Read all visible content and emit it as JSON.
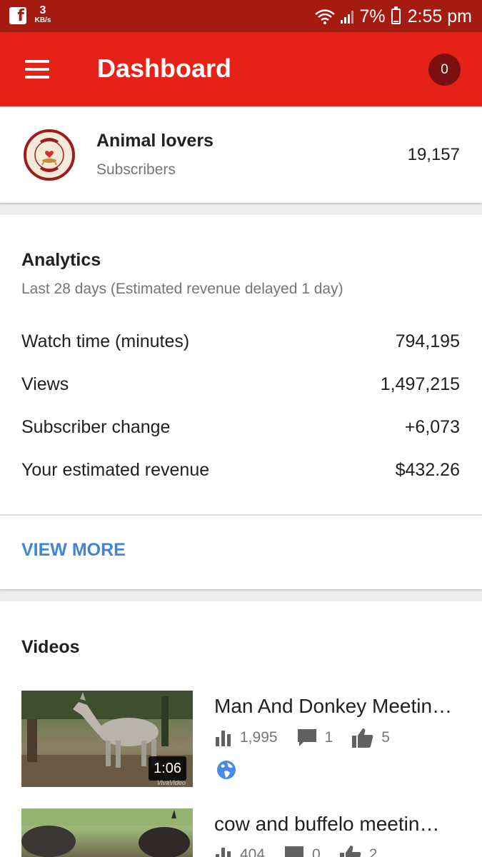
{
  "status_bar": {
    "app_icon": "facebook-icon",
    "net_speed": "3",
    "net_speed_unit": "KB/s",
    "battery": "7%",
    "time": "2:55 pm"
  },
  "app_bar": {
    "title": "Dashboard",
    "notification_count": "0",
    "color": "#e62117"
  },
  "channel": {
    "name": "Animal lovers",
    "subscribers_label": "Subscribers",
    "subscriber_count": "19,157"
  },
  "analytics": {
    "title": "Analytics",
    "subtitle": "Last 28 days (Estimated revenue delayed 1 day)",
    "metrics": [
      {
        "label": "Watch time (minutes)",
        "value": "794,195"
      },
      {
        "label": "Views",
        "value": "1,497,215"
      },
      {
        "label": "Subscriber change",
        "value": "+6,073"
      },
      {
        "label": "Your estimated revenue",
        "value": "$432.26"
      }
    ],
    "view_more": "VIEW MORE"
  },
  "videos": {
    "title": "Videos",
    "items": [
      {
        "title": "Man And Donkey Meetin…",
        "duration": "1:06",
        "views": "1,995",
        "comments": "1",
        "likes": "5",
        "visibility_icon": "globe-icon"
      },
      {
        "title": "cow and buffelo meetin…",
        "views": "404",
        "comments": "0",
        "likes": "2"
      }
    ]
  }
}
